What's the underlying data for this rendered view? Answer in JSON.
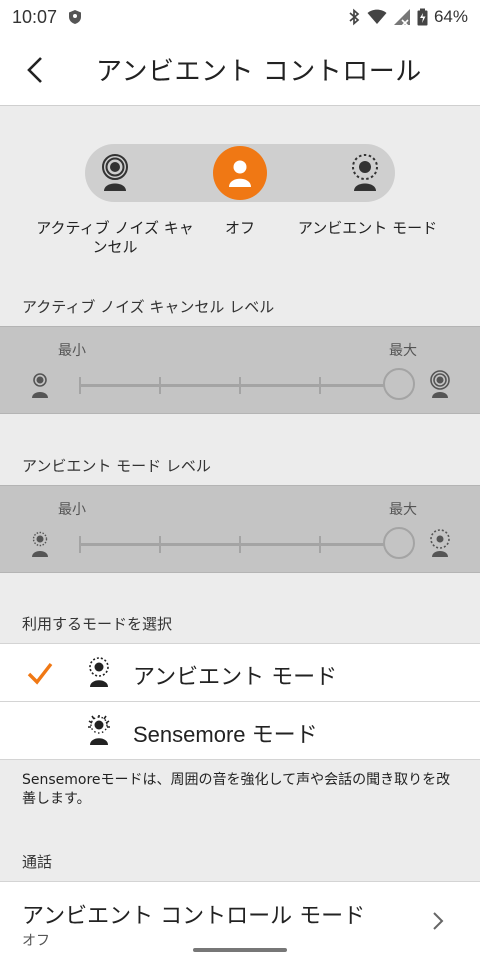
{
  "status_bar": {
    "time": "10:07",
    "battery": "64%"
  },
  "header": {
    "title": "アンビエント コントロール"
  },
  "mode_switch": {
    "options": [
      {
        "label": "アクティブ ノイズ キャンセル"
      },
      {
        "label": "オフ"
      },
      {
        "label": "アンビエント モード"
      }
    ],
    "selected": "オフ",
    "accent_color": "#f07814"
  },
  "anc_level": {
    "heading": "アクティブ ノイズ キャンセル レベル",
    "min_label": "最小",
    "max_label": "最大"
  },
  "ambient_level": {
    "heading": "アンビエント モード レベル",
    "min_label": "最小",
    "max_label": "最大"
  },
  "mode_select": {
    "heading": "利用するモードを選択",
    "items": [
      {
        "label": "アンビエント モード",
        "checked": true
      },
      {
        "label": "Sensemore モード",
        "checked": false
      }
    ],
    "note": "Sensemoreモードは、周囲の音を強化して声や会話の聞き取りを改善します。"
  },
  "call": {
    "heading": "通話",
    "item_title": "アンビエント コントロール モード",
    "item_value": "オフ"
  }
}
